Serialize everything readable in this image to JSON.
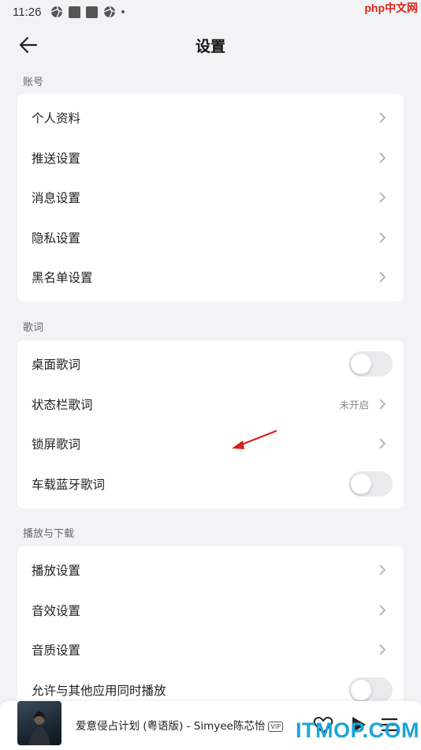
{
  "status_bar": {
    "time": "11:26",
    "watermark": "php中文网"
  },
  "header": {
    "title": "设置"
  },
  "sections": [
    {
      "label": "账号",
      "rows": [
        {
          "label": "个人资料",
          "control": "chevron"
        },
        {
          "label": "推送设置",
          "control": "chevron"
        },
        {
          "label": "消息设置",
          "control": "chevron"
        },
        {
          "label": "隐私设置",
          "control": "chevron"
        },
        {
          "label": "黑名单设置",
          "control": "chevron"
        }
      ]
    },
    {
      "label": "歌词",
      "rows": [
        {
          "label": "桌面歌词",
          "control": "toggle",
          "on": false
        },
        {
          "label": "状态栏歌词",
          "control": "chevron",
          "value": "未开启"
        },
        {
          "label": "锁屏歌词",
          "control": "chevron"
        },
        {
          "label": "车载蓝牙歌词",
          "control": "toggle",
          "on": false
        }
      ]
    },
    {
      "label": "播放与下载",
      "rows": [
        {
          "label": "播放设置",
          "control": "chevron"
        },
        {
          "label": "音效设置",
          "control": "chevron"
        },
        {
          "label": "音质设置",
          "control": "chevron"
        },
        {
          "label": "允许与其他应用同时播放",
          "control": "toggle",
          "on": false
        }
      ]
    }
  ],
  "player": {
    "song": "爱意侵占计划 (粤语版) - Simyee陈芯怡",
    "badge": "VIP"
  },
  "watermark_bottom": "ITMOP.COM",
  "colors": {
    "accent_arrow": "#d9201e",
    "toggle_off": "#e9eaec",
    "page_bg": "#f2f3f5"
  }
}
